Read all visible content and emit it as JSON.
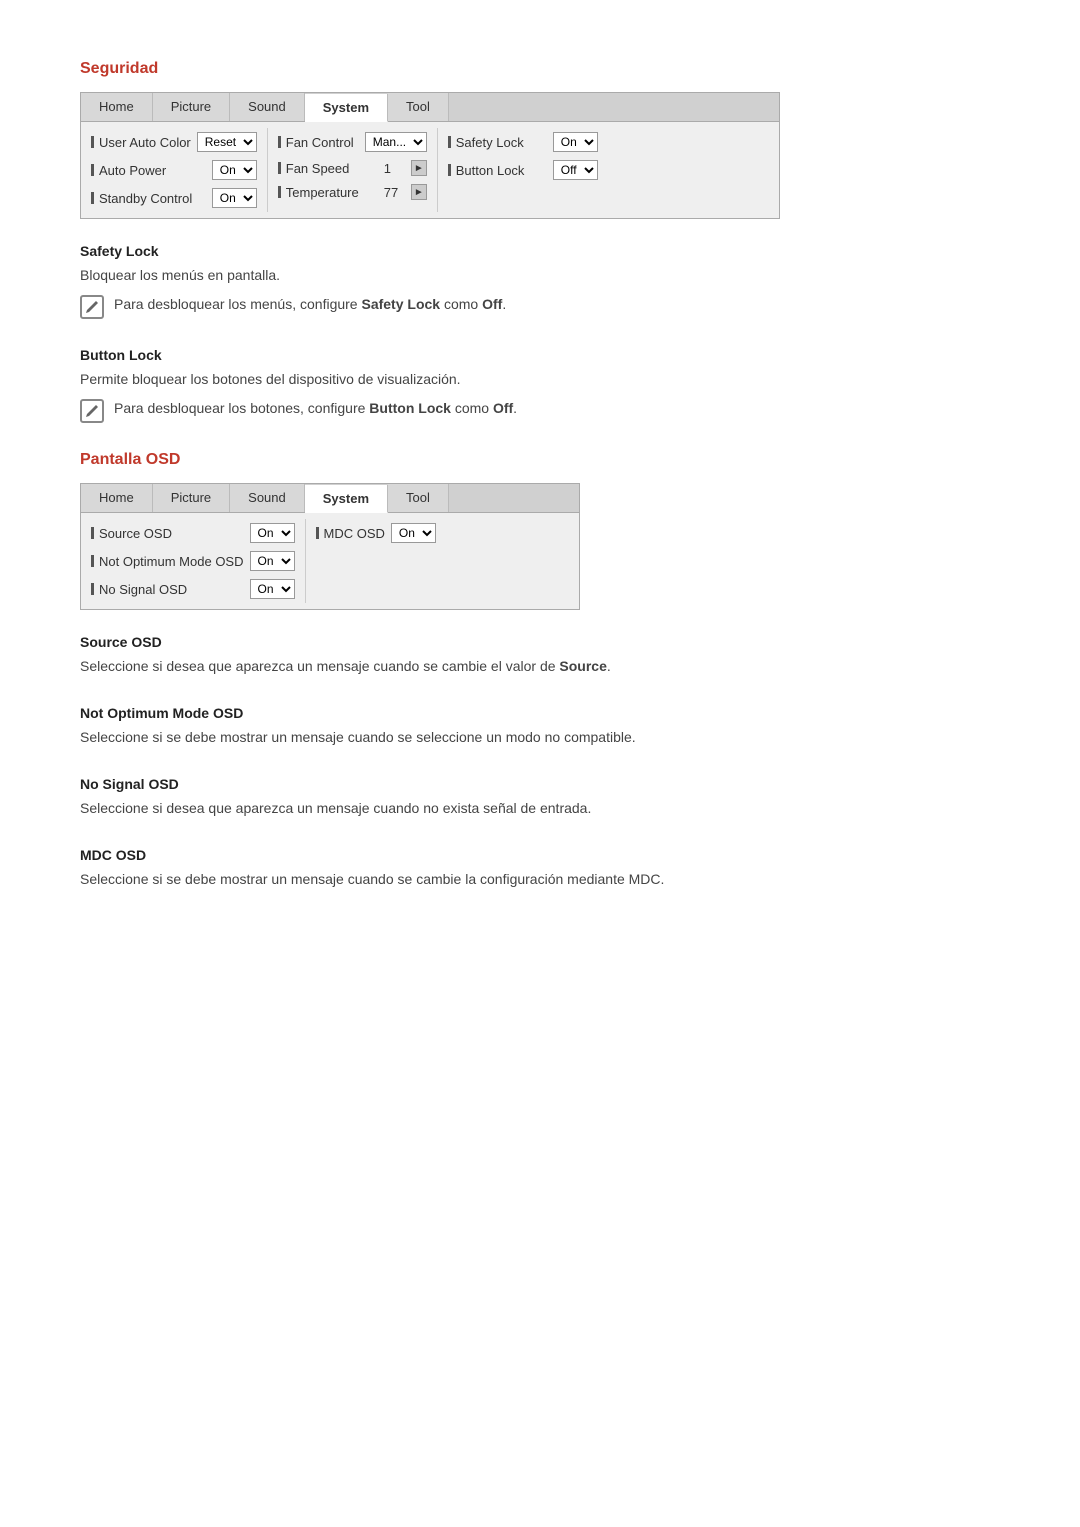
{
  "page": {
    "sections": {
      "seguridad": {
        "title": "Seguridad",
        "menu": {
          "tabs": [
            {
              "label": "Home",
              "active": false
            },
            {
              "label": "Picture",
              "active": false
            },
            {
              "label": "Sound",
              "active": false
            },
            {
              "label": "System",
              "active": true
            },
            {
              "label": "Tool",
              "active": false
            }
          ],
          "columns": [
            {
              "rows": [
                {
                  "label": "User Auto Color",
                  "control": "select",
                  "value": "Reset"
                },
                {
                  "label": "Auto Power",
                  "control": "select",
                  "value": "On"
                },
                {
                  "label": "Standby Control",
                  "control": "select",
                  "value": "On"
                }
              ]
            },
            {
              "rows": [
                {
                  "label": "Fan Control",
                  "control": "select",
                  "value": "Man..."
                },
                {
                  "label": "Fan Speed",
                  "control": "arrow",
                  "value": "1"
                },
                {
                  "label": "Temperature",
                  "control": "arrow",
                  "value": "77"
                }
              ]
            },
            {
              "rows": [
                {
                  "label": "Safety Lock",
                  "control": "select",
                  "value": "On"
                },
                {
                  "label": "Button Lock",
                  "control": "select",
                  "value": "Off"
                }
              ]
            }
          ]
        },
        "safety_lock": {
          "subtitle": "Safety Lock",
          "body": "Bloquear los menús en pantalla.",
          "note": "Para desbloquear los menús, configure Safety Lock como Off.",
          "note_bold_start": "Safety Lock",
          "note_bold_end": "Off"
        },
        "button_lock": {
          "subtitle": "Button Lock",
          "body": "Permite bloquear los botones del dispositivo de visualización.",
          "note": "Para desbloquear los botones, configure Button Lock como Off.",
          "note_bold_start": "Button Lock",
          "note_bold_end": "Off"
        }
      },
      "pantalla_osd": {
        "title": "Pantalla OSD",
        "menu": {
          "tabs": [
            {
              "label": "Home",
              "active": false
            },
            {
              "label": "Picture",
              "active": false
            },
            {
              "label": "Sound",
              "active": false
            },
            {
              "label": "System",
              "active": true
            },
            {
              "label": "Tool",
              "active": false
            }
          ],
          "columns": [
            {
              "rows": [
                {
                  "label": "Source OSD",
                  "control": "select",
                  "value": "On"
                },
                {
                  "label": "Not Optimum Mode OSD",
                  "control": "select",
                  "value": "On"
                },
                {
                  "label": "No Signal OSD",
                  "control": "select",
                  "value": "On"
                }
              ]
            },
            {
              "rows": [
                {
                  "label": "MDC OSD",
                  "control": "select",
                  "value": "On"
                }
              ]
            }
          ]
        },
        "source_osd": {
          "subtitle": "Source OSD",
          "body": "Seleccione si desea que aparezca un mensaje cuando se cambie el valor de Source."
        },
        "not_optimum_osd": {
          "subtitle": "Not Optimum Mode OSD",
          "body": "Seleccione si se debe mostrar un mensaje cuando se seleccione un modo no compatible."
        },
        "no_signal_osd": {
          "subtitle": "No Signal OSD",
          "body": "Seleccione si desea que aparezca un mensaje cuando no exista señal de entrada."
        },
        "mdc_osd": {
          "subtitle": "MDC OSD",
          "body": "Seleccione si se debe mostrar un mensaje cuando se cambie la configuración mediante MDC."
        }
      }
    }
  }
}
